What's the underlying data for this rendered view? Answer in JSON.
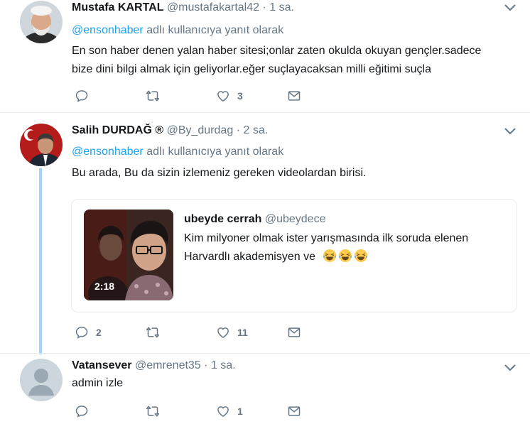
{
  "tweets": [
    {
      "name": "Mustafa KARTAL",
      "handle": "@mustafakartal42",
      "dot": "·",
      "time": "1 sa.",
      "reply_prefix": "@ensonhaber",
      "reply_suffix": " adlı kullanıcıya yanıt olarak",
      "text_line1": "En son haber denen yalan haber sitesi;onlar zaten okulda okuyan gençler.sadece",
      "text_line2": "bize dini bilgi almak için geliyorlar.eğer suçlayacaksan milli eğitimi suçla",
      "reply_count": "",
      "retweet_count": "",
      "like_count": "3"
    },
    {
      "name": "Salih DURDAĞ ®",
      "handle": "@By_durdag",
      "dot": "·",
      "time": "2 sa.",
      "reply_prefix": "@ensonhaber",
      "reply_suffix": " adlı kullanıcıya yanıt olarak",
      "text_line1": "Bu arada, Bu da sizin izlemeniz gereken videolardan birisi.",
      "reply_count": "2",
      "retweet_count": "",
      "like_count": "11"
    },
    {
      "name": "Vatansever",
      "handle": "@emrenet35",
      "dot": "·",
      "time": "1 sa.",
      "text_line1": "admin izle",
      "reply_count": "",
      "retweet_count": "",
      "like_count": "1"
    }
  ],
  "quoted": {
    "name": "ubeyde cerrah",
    "handle": "@ubeydece",
    "text_line1": "Kim milyoner olmak ister yarışmasında ilk soruda elenen",
    "text_line2": "Harvardlı akademisyen ve",
    "video_duration": "2:18"
  },
  "colors": {
    "accent": "#1da1f2",
    "secondary_text": "#657786",
    "thread_line": "#a5d4f3",
    "divider": "#e6ecf0"
  },
  "icons": [
    "reply-icon",
    "retweet-icon",
    "like-icon",
    "dm-icon",
    "chevron-down-icon",
    "laughing-emoji"
  ]
}
